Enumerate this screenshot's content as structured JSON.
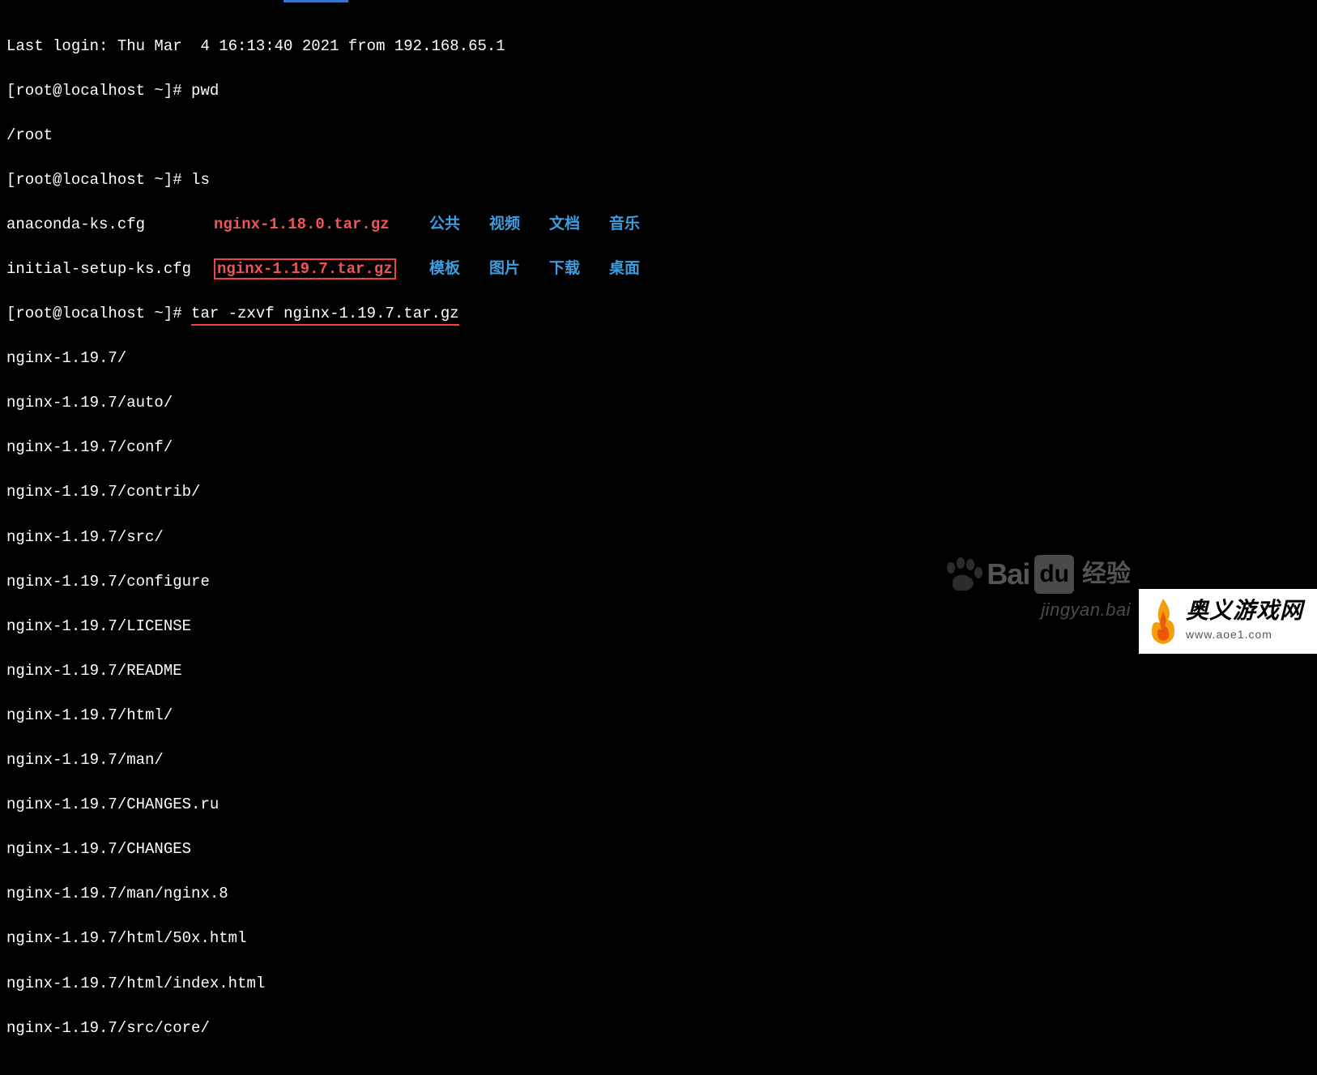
{
  "terminal": {
    "last_login": "Last login: Thu Mar  4 16:13:40 2021 from 192.168.65.1",
    "prompt": "[root@localhost ~]# ",
    "cmd_pwd": "pwd",
    "pwd_output": "/root",
    "cmd_ls": "ls",
    "ls": {
      "row1": {
        "c1": "anaconda-ks.cfg",
        "c2": "nginx-1.18.0.tar.gz",
        "c3": "公共",
        "c4": "视频",
        "c5": "文档",
        "c6": "音乐"
      },
      "row2": {
        "c1": "initial-setup-ks.cfg",
        "c2": "nginx-1.19.7.tar.gz",
        "c3": "模板",
        "c4": "图片",
        "c5": "下载",
        "c6": "桌面"
      }
    },
    "cmd_tar": "tar -zxvf nginx-1.19.7.tar.gz",
    "tar_output": [
      "nginx-1.19.7/",
      "nginx-1.19.7/auto/",
      "nginx-1.19.7/conf/",
      "nginx-1.19.7/contrib/",
      "nginx-1.19.7/src/",
      "nginx-1.19.7/configure",
      "nginx-1.19.7/LICENSE",
      "nginx-1.19.7/README",
      "nginx-1.19.7/html/",
      "nginx-1.19.7/man/",
      "nginx-1.19.7/CHANGES.ru",
      "nginx-1.19.7/CHANGES",
      "nginx-1.19.7/man/nginx.8",
      "nginx-1.19.7/html/50x.html",
      "nginx-1.19.7/html/index.html",
      "nginx-1.19.7/src/core/"
    ]
  },
  "watermark": {
    "brand_bai": "Bai",
    "brand_du": "du",
    "brand_cn": "经验",
    "url": "jingyan.bai"
  },
  "badge": {
    "title": "奥义游戏网",
    "url": "www.aoe1.com"
  }
}
